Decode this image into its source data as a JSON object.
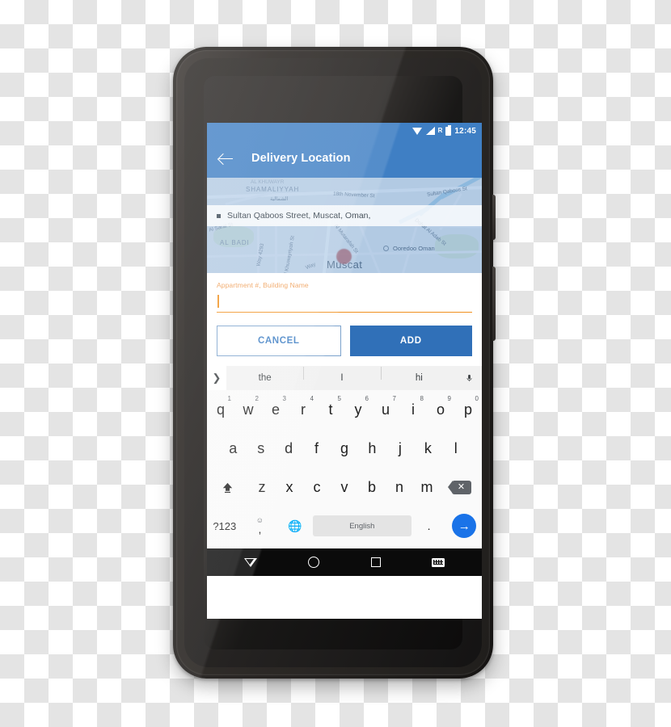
{
  "statusbar": {
    "time": "12:45",
    "roaming": "R",
    "icons": [
      "wifi-icon",
      "signal-icon",
      "roaming-icon",
      "battery-icon"
    ]
  },
  "appbar": {
    "title": "Delivery Location",
    "back_icon": "back-arrow-icon",
    "color": "#3f7fc4"
  },
  "map": {
    "address": "Sultan Qaboos Street, Muscat, Oman,",
    "marker_icon": "square-marker-icon",
    "labels": [
      "SHAMALIYYAH",
      "الشمالية",
      "18th November St",
      "Sultan Qaboos St",
      "Al Sarat St",
      "AL BADI",
      "Way 4293",
      "Al Khuwayriyah St",
      "Al Mutarafah St",
      "Way",
      "Dohat Al Adab St",
      "Muscat"
    ],
    "poi": "Ooredoo Oman",
    "pin_color": "#c0504d",
    "tint_color": "#3f7fc4"
  },
  "form": {
    "field_label": "Appartment #, Building Name",
    "field_value": "",
    "label_color": "#ef9b52",
    "underline_color": "#f0901e",
    "cancel_label": "CANCEL",
    "add_label": "ADD",
    "add_color": "#3070b8"
  },
  "keyboard": {
    "expand_icon": "chevron-right-icon",
    "suggestions": [
      "the",
      "I",
      "hi"
    ],
    "mic_icon": "microphone-icon",
    "row1": [
      {
        "key": "q",
        "num": "1"
      },
      {
        "key": "w",
        "num": "2"
      },
      {
        "key": "e",
        "num": "3"
      },
      {
        "key": "r",
        "num": "4"
      },
      {
        "key": "t",
        "num": "5"
      },
      {
        "key": "y",
        "num": "6"
      },
      {
        "key": "u",
        "num": "7"
      },
      {
        "key": "i",
        "num": "8"
      },
      {
        "key": "o",
        "num": "9"
      },
      {
        "key": "p",
        "num": "0"
      }
    ],
    "row2": [
      "a",
      "s",
      "d",
      "f",
      "g",
      "h",
      "j",
      "k",
      "l"
    ],
    "row3": [
      "z",
      "x",
      "c",
      "v",
      "b",
      "n",
      "m"
    ],
    "shift_icon": "shift-arrow-icon",
    "delete_icon": "backspace-icon",
    "symbols_label": "?123",
    "emoji_icon": "emoji-smiley-icon",
    "comma_label": ",",
    "globe_icon": "globe-language-icon",
    "space_label": "English",
    "period_label": ".",
    "enter_icon": "enter-arrow-icon"
  },
  "navbar": {
    "back_icon": "nav-back-triangle-icon",
    "home_icon": "nav-home-circle-icon",
    "recents_icon": "nav-recents-square-icon",
    "keyboard_icon": "nav-keyboard-icon"
  },
  "device": {
    "camera_icon": "front-camera-icon",
    "earpiece_icon": "earpiece-speaker-icon",
    "sensor_icon": "proximity-sensor-icon",
    "power_button": "power-button",
    "volume_button": "volume-button"
  }
}
